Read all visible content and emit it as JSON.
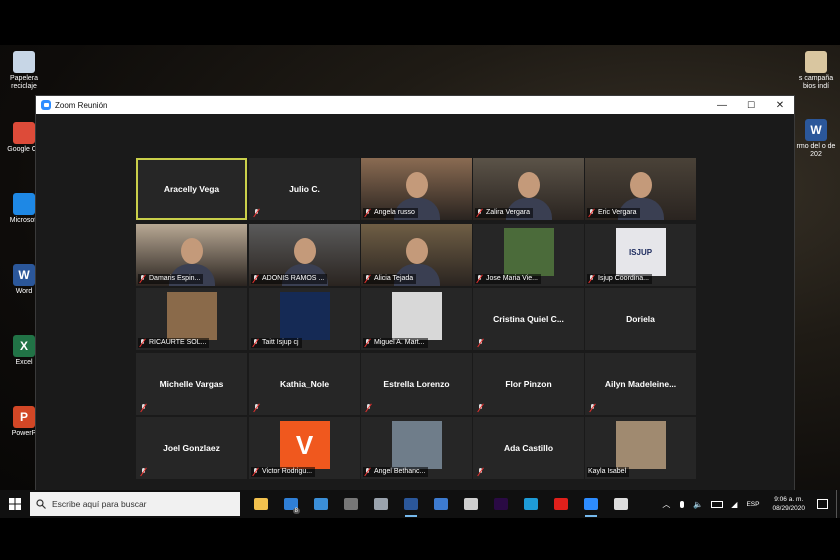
{
  "window": {
    "title": "Zoom Reunión",
    "min_glyph": "—",
    "max_glyph": "☐",
    "close_glyph": "✕"
  },
  "desktop_left": [
    {
      "label": "Papelera de reciclaje",
      "short": "Papelera reciclaje",
      "color": "#c7d6e6",
      "glyph": ""
    },
    {
      "label": "Google Chrome",
      "short": "Google Ch",
      "color": "#dd4b39",
      "glyph": ""
    },
    {
      "label": "Microsoft Edge",
      "short": "Microsoft",
      "color": "#1e88e5",
      "glyph": ""
    },
    {
      "label": "Word",
      "short": "Word",
      "color": "#2b579a",
      "glyph": "W"
    },
    {
      "label": "Excel",
      "short": "Excel",
      "color": "#217346",
      "glyph": "X"
    },
    {
      "label": "PowerPoint",
      "short": "PowerP",
      "color": "#d24726",
      "glyph": "P"
    }
  ],
  "desktop_right": [
    {
      "short": "s campaña bios indí",
      "color": "#d9c6a0",
      "glyph": ""
    },
    {
      "short": "rmo del o de 202",
      "color": "#2b579a",
      "glyph": "W"
    }
  ],
  "participants": [
    {
      "name": "Aracelly Vega",
      "type": "name",
      "active": true,
      "mic": false
    },
    {
      "name": "Julio C.",
      "type": "name",
      "mic": true
    },
    {
      "name": "Angela russo",
      "type": "video",
      "bg": "#8a6b52",
      "mic": true
    },
    {
      "name": "Zalira Vergara",
      "type": "video",
      "bg": "#5b5348",
      "mic": true
    },
    {
      "name": "Eric Vergara",
      "type": "video",
      "bg": "#4a4238",
      "mic": true
    },
    {
      "name": "Damaris Espin...",
      "type": "video",
      "bg": "#b8a894",
      "mic": true
    },
    {
      "name": "ADONIS RAMOS ...",
      "type": "video",
      "bg": "#5a5a5a",
      "mic": true
    },
    {
      "name": "Alicia Tejada",
      "type": "video",
      "bg": "#6f5e45",
      "mic": true
    },
    {
      "name": "Jose Maria Vie...",
      "type": "pic",
      "bg": "#4b6b3a",
      "mic": true
    },
    {
      "name": "Isjup Coordina...",
      "type": "pic",
      "bg": "#e6e6ea",
      "mic": true,
      "pic_text": "ISJUP"
    },
    {
      "name": "RICAURTE SOL...",
      "type": "pic",
      "bg": "#8a6a4a",
      "mic": true
    },
    {
      "name": "Taitt Isjup cj",
      "type": "pic",
      "bg": "#152a55",
      "mic": true
    },
    {
      "name": "Miguel A. Mart...",
      "type": "pic",
      "bg": "#d8d8d8",
      "mic": true
    },
    {
      "name": "Cristina Quiel C...",
      "type": "name",
      "mic": true
    },
    {
      "name": "Doriela",
      "type": "name",
      "mic": false
    },
    {
      "name": "Michelle Vargas",
      "type": "name",
      "mic": true
    },
    {
      "name": "Kathia_Nole",
      "type": "name",
      "mic": true
    },
    {
      "name": "Estrella Lorenzo",
      "type": "name",
      "mic": true
    },
    {
      "name": "Flor Pinzon",
      "type": "name",
      "mic": true
    },
    {
      "name": "Ailyn Madeleine...",
      "type": "name",
      "mic": true
    },
    {
      "name": "Joel Gonzlaez",
      "type": "name",
      "mic": true
    },
    {
      "name": "Victor Rodrigu...",
      "type": "pic",
      "bg": "#f0581e",
      "mic": true,
      "pic_text": "V"
    },
    {
      "name": "Angel Bethanc...",
      "type": "pic",
      "bg": "#6f7d8a",
      "mic": true
    },
    {
      "name": "Ada Castillo",
      "type": "name",
      "mic": true
    },
    {
      "name": "Kayla Isabel",
      "type": "pic",
      "bg": "#a08a70",
      "mic": false
    }
  ],
  "taskbar": {
    "search_placeholder": "Escribe aquí para buscar",
    "apps": [
      {
        "name": "file-explorer",
        "color": "#f2c14e",
        "open": false
      },
      {
        "name": "mail",
        "color": "#2f7fd6",
        "open": false,
        "badge": "8"
      },
      {
        "name": "photos",
        "color": "#3b8fd8",
        "open": false
      },
      {
        "name": "camera",
        "color": "#777777",
        "open": false
      },
      {
        "name": "speed",
        "color": "#9aa3ad",
        "open": false
      },
      {
        "name": "word",
        "color": "#2b579a",
        "open": true
      },
      {
        "name": "thunderbird",
        "color": "#3d7bd0",
        "open": false
      },
      {
        "name": "security",
        "color": "#cfcfcf",
        "open": false
      },
      {
        "name": "premiere",
        "color": "#2a0a44",
        "open": false
      },
      {
        "name": "edge",
        "color": "#1e9bd7",
        "open": false
      },
      {
        "name": "opera",
        "color": "#e0201b",
        "open": false
      },
      {
        "name": "zoom",
        "color": "#2d8cff",
        "open": true
      },
      {
        "name": "settings",
        "color": "#dddddd",
        "open": false
      }
    ],
    "language": "ESP",
    "time": "9:06 a. m.",
    "date": "08/29/2020"
  }
}
